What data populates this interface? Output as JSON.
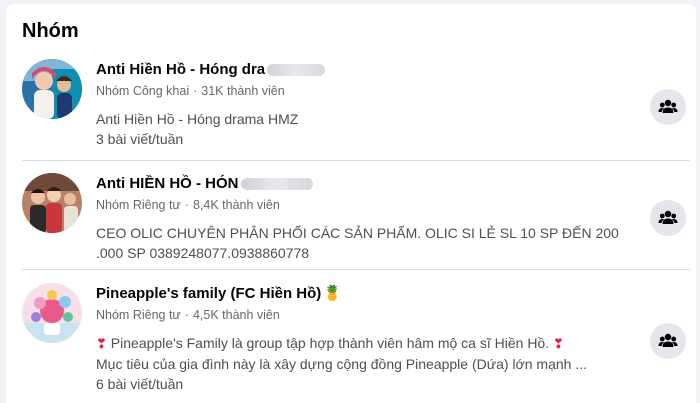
{
  "section": {
    "title": "Nhóm"
  },
  "groups": [
    {
      "name": "Anti Hiền Hồ - Hóng dra",
      "privacy": "Nhóm Công khai",
      "members": "31K thành viên",
      "description_lines": [
        "Anti Hiền Hồ - Hóng drama HMZ"
      ],
      "frequency": "3 bài viết/tuần"
    },
    {
      "name": "Anti HIỀN HỒ - HÓN",
      "privacy": "Nhóm Riêng tư",
      "members": "8,4K thành viên",
      "description_lines": [
        "CEO OLIC CHUYÊN PHÂN PHỐI CÁC SẢN PHẨM. OLIC SI LẺ SL 10 SP ĐẾN 200",
        ".000 SP 0389248077.0938860778"
      ],
      "frequency": ""
    },
    {
      "name": "Pineapple's family (FC Hiền Hồ)",
      "privacy": "Nhóm Riêng tư",
      "members": "4,5K thành viên",
      "description_lines": [
        "Pineapple's Family là group tập hợp thành viên hâm mộ ca sĩ Hiền Hồ.",
        "Mục tiêu của gia đình này là xây dựng cộng đồng Pineapple (Dứa) lớn mạnh ..."
      ],
      "frequency": "6 bài viết/tuần"
    }
  ],
  "separator": "·",
  "heart_glyph": "❣",
  "pineapple_glyph": "🍍",
  "icons": [
    "group-join-icon",
    "lock-icon",
    "avatar-image"
  ],
  "colors": {
    "background": "#f0f2f5",
    "card": "#ffffff",
    "secondary_text": "#65676b",
    "button_bg": "#e4e6eb"
  }
}
